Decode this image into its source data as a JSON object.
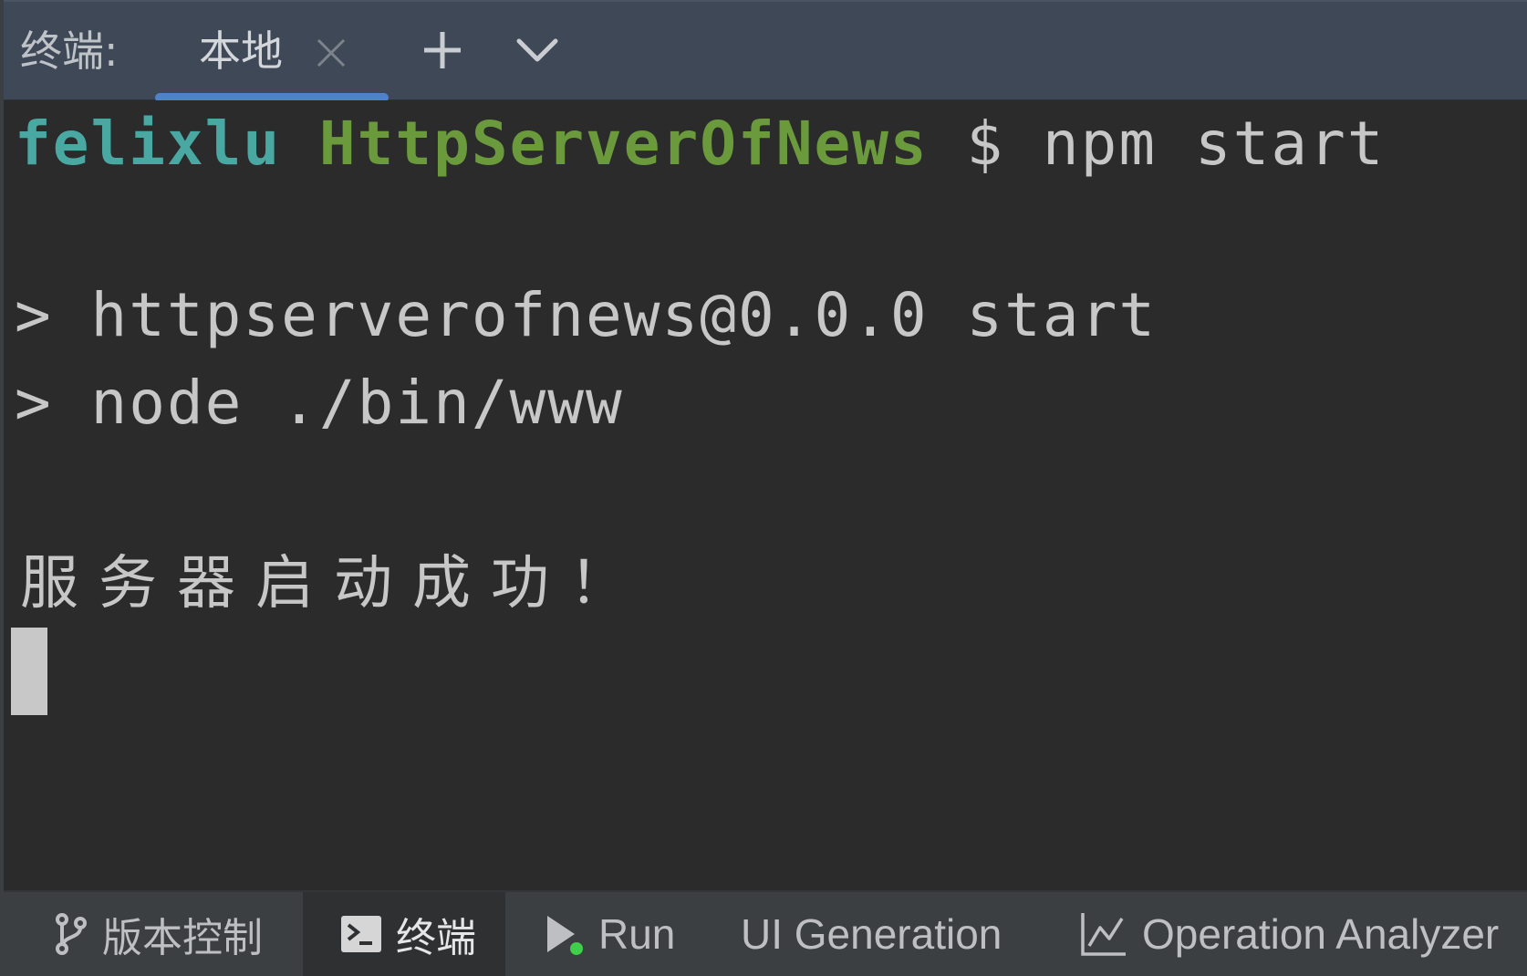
{
  "tabbar": {
    "label": "终端:",
    "tabs": [
      {
        "label": "本地",
        "active": true
      }
    ],
    "close_icon": "close-icon",
    "add_icon": "plus-icon",
    "menu_icon": "chevron-down-icon",
    "accent_color": "#4f82c9"
  },
  "terminal": {
    "prompt": {
      "user": "felixlu",
      "directory": "HttpServerOfNews",
      "symbol": "$",
      "command": "npm start"
    },
    "output": [
      "> httpserverofnews@0.0.0 start",
      "> node ./bin/www",
      "服务器启动成功！"
    ],
    "colors": {
      "user": "#4aa8a3",
      "directory": "#6a9a3c",
      "text": "#c7c7c7",
      "background": "#2b2b2b"
    }
  },
  "bottombar": {
    "tabs": [
      {
        "label": "版本控制",
        "icon": "git-branch-icon",
        "active": false
      },
      {
        "label": "终端",
        "icon": "terminal-icon",
        "active": true
      },
      {
        "label": "Run",
        "icon": "run-icon",
        "active": false
      },
      {
        "label": "UI Generation",
        "icon": "",
        "active": false
      },
      {
        "label": "Operation Analyzer",
        "icon": "chart-line-icon",
        "active": false
      }
    ]
  }
}
